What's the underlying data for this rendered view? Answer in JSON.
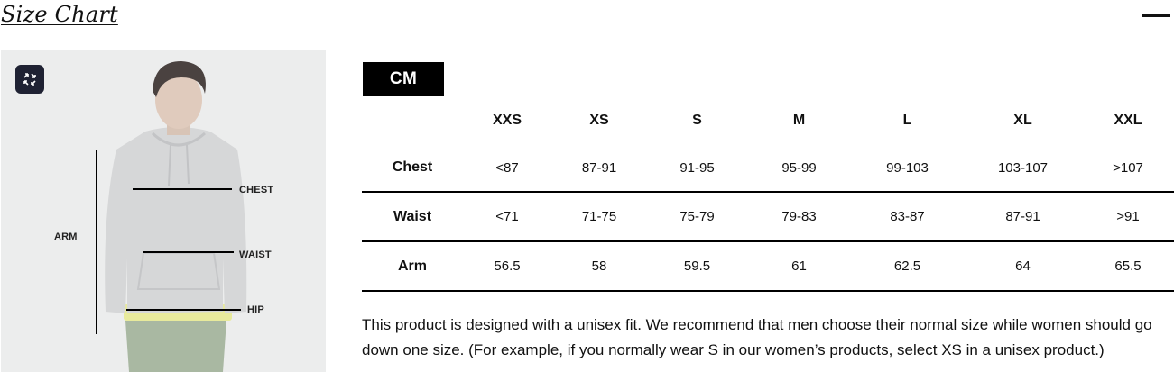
{
  "header": {
    "title": "Size Chart"
  },
  "image_panel": {
    "labels": {
      "arm": "ARM",
      "chest": "CHEST",
      "waist": "WAIST",
      "hip": "HIP"
    },
    "zoom_icon": "expand-icon"
  },
  "unit_tab": {
    "label": "CM"
  },
  "size_table": {
    "columns": [
      "XXS",
      "XS",
      "S",
      "M",
      "L",
      "XL",
      "XXL"
    ],
    "rows": [
      {
        "label": "Chest",
        "values": [
          "<87",
          "87-91",
          "91-95",
          "95-99",
          "99-103",
          "103-107",
          ">107"
        ]
      },
      {
        "label": "Waist",
        "values": [
          "<71",
          "71-75",
          "75-79",
          "79-83",
          "83-87",
          "87-91",
          ">91"
        ]
      },
      {
        "label": "Arm",
        "values": [
          "56.5",
          "58",
          "59.5",
          "61",
          "62.5",
          "64",
          "65.5"
        ]
      }
    ]
  },
  "fit_note": "This product is designed with a unisex fit. We recommend that men choose their normal size while women should go down one size. (For example, if you normally wear S in our women’s products, select XS in a unisex product.)",
  "colors": {
    "tab_bg": "#000000",
    "zoom_button_bg": "#1f2233",
    "image_bg": "#eceded"
  }
}
